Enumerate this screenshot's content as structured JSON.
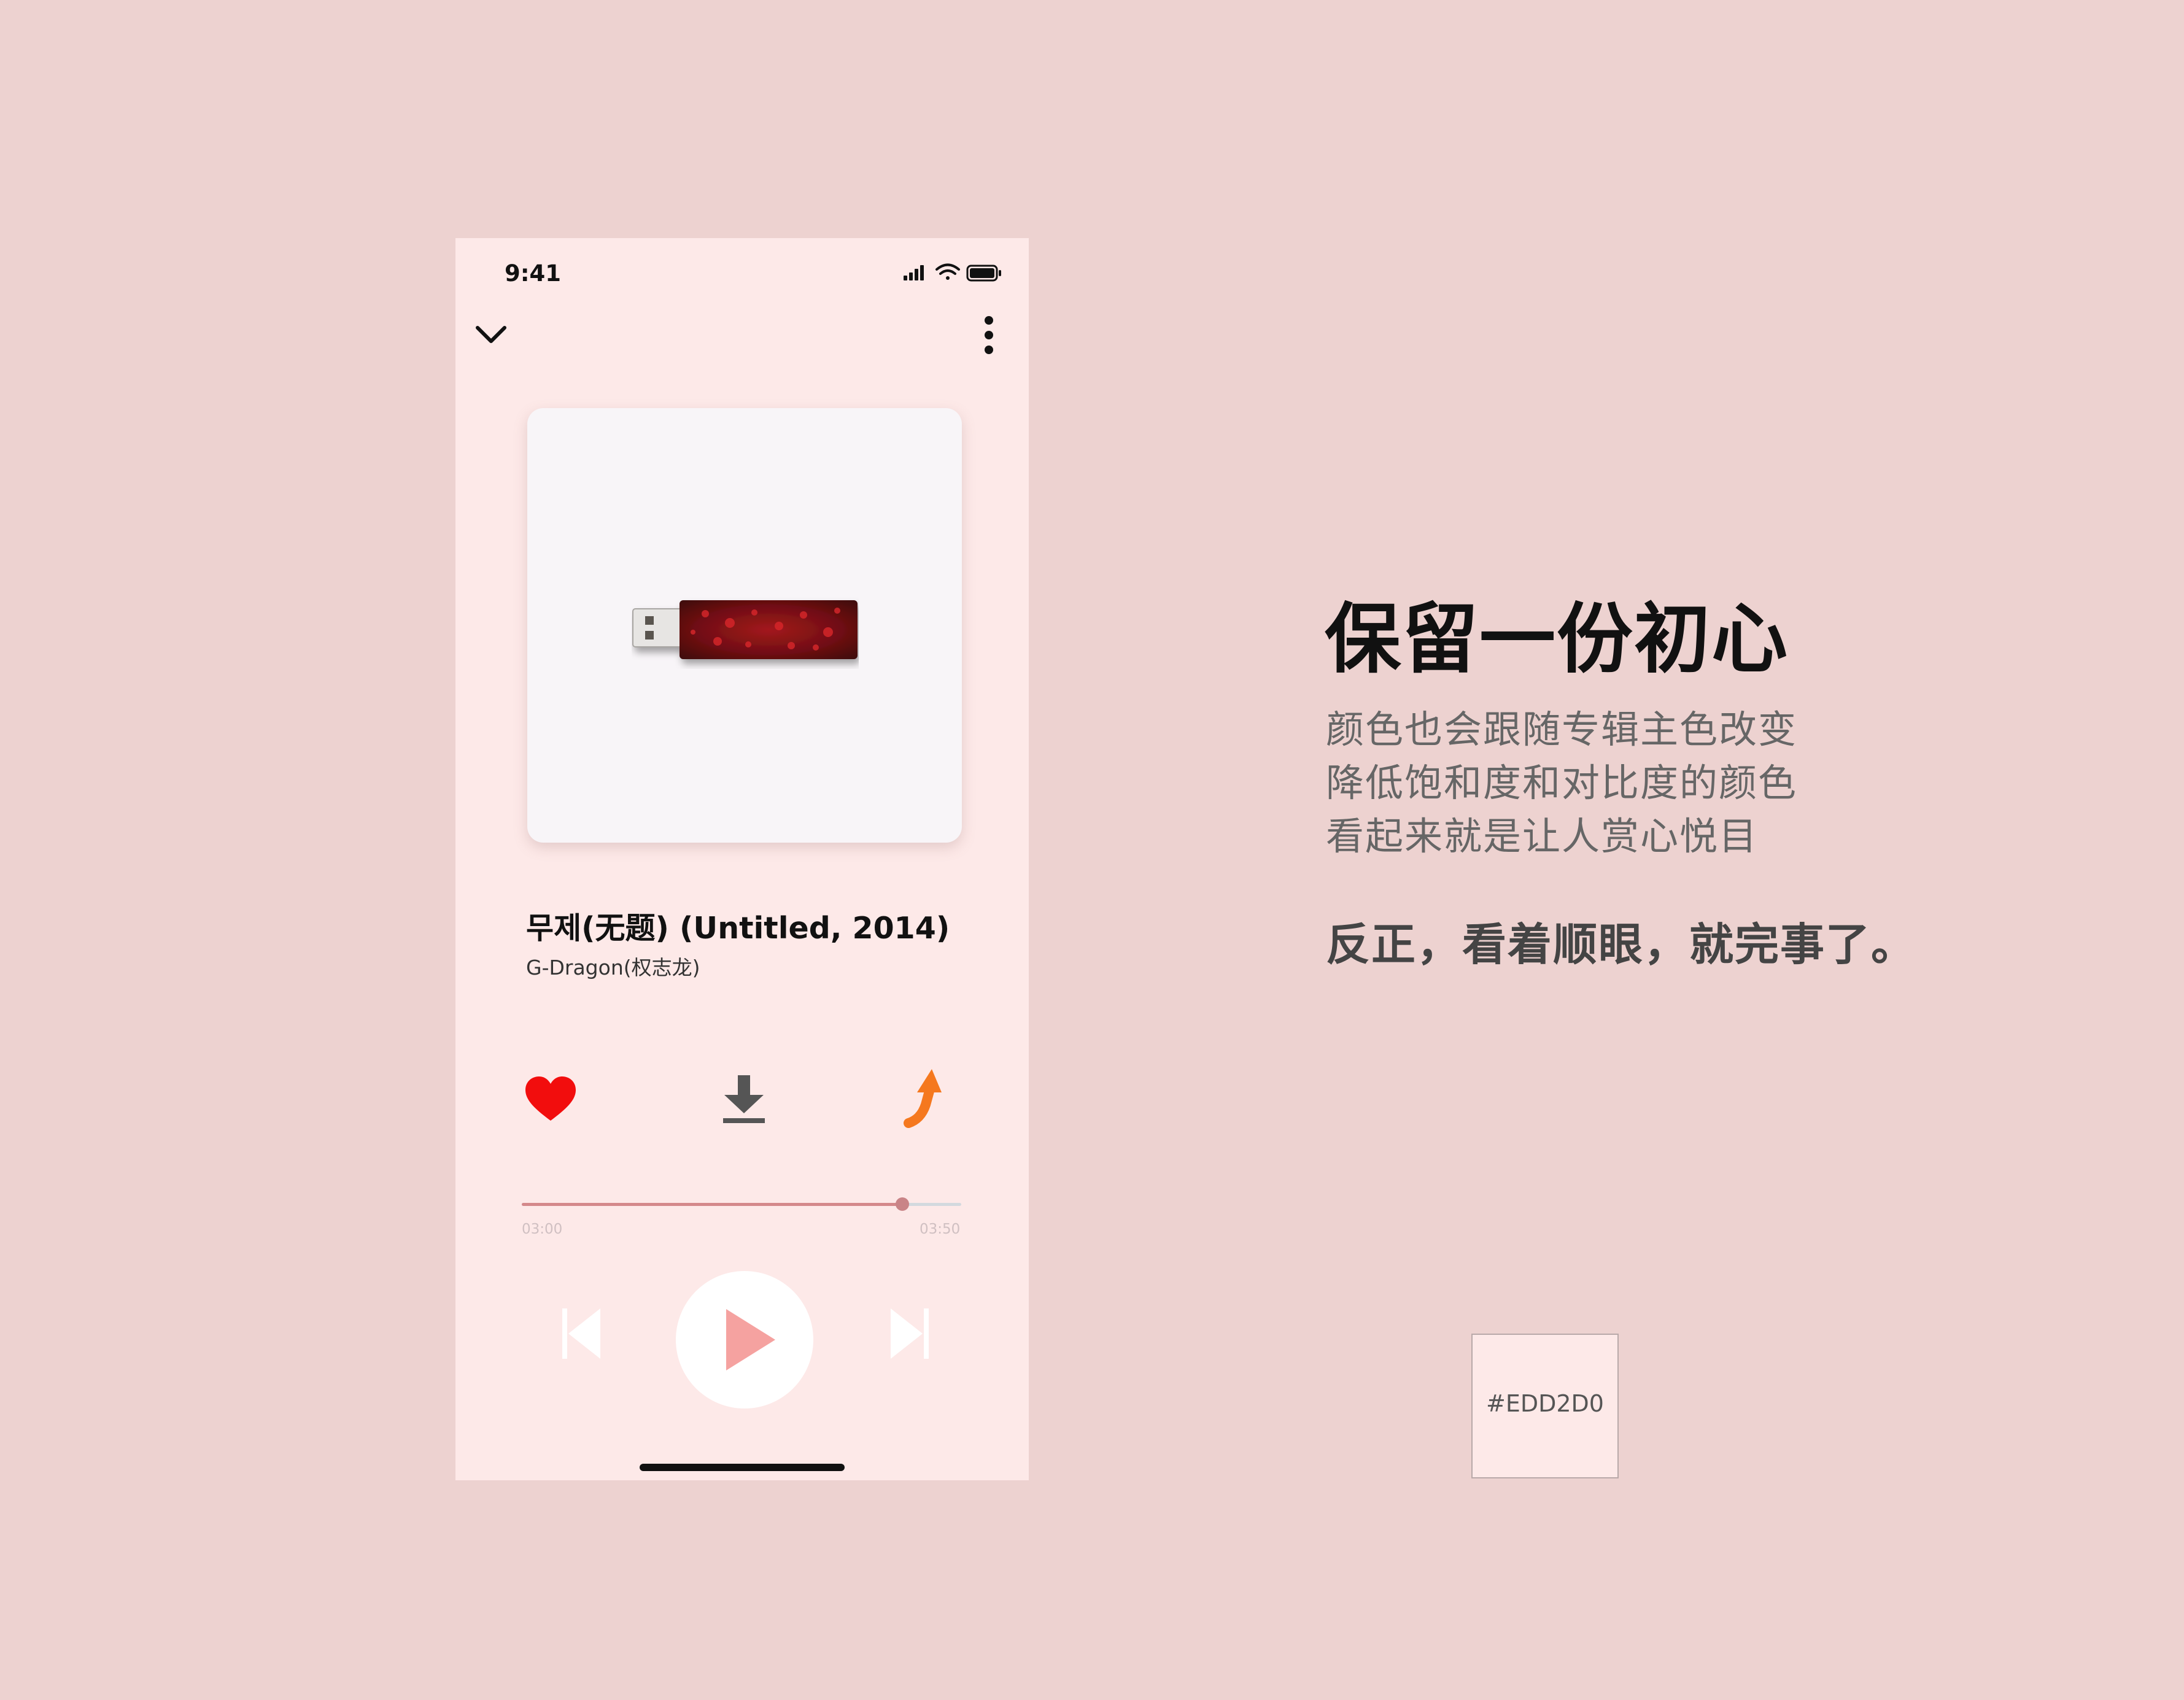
{
  "status_bar": {
    "time": "9:41"
  },
  "top_nav": {
    "collapse_icon": "chevron-down-icon",
    "menu_icon": "more-vertical-icon"
  },
  "album_art": {
    "description_icon": "usb-drive-icon"
  },
  "song": {
    "title": "무제(无题) (Untitled, 2014)",
    "artist": "G-Dragon(权志龙)"
  },
  "actions": {
    "like_icon": "heart-icon",
    "download_icon": "download-icon",
    "share_icon": "share-icon"
  },
  "progress": {
    "current": "03:00",
    "total": "03:50",
    "fraction": 0.866
  },
  "controls": {
    "prev_icon": "skip-previous-icon",
    "play_icon": "play-icon",
    "next_icon": "skip-next-icon"
  },
  "info": {
    "headline": "保留一份初心",
    "lines": [
      "颜色也会跟随专辑主色改变",
      "降低饱和度和对比度的颜色",
      "看起来就是让人赏心悦目"
    ],
    "tagline": "反正，看着顺眼，就完事了。"
  },
  "swatch": {
    "label": "#EDD2D0",
    "color": "#EDD2D0"
  },
  "colors": {
    "page_bg": "#EDD2D0",
    "phone_bg": "#FDE9E8",
    "heart": "#F20D0D",
    "share": "#F5781E",
    "download": "#555555",
    "progress": "#D4888A",
    "play": "#F5A2A0"
  }
}
